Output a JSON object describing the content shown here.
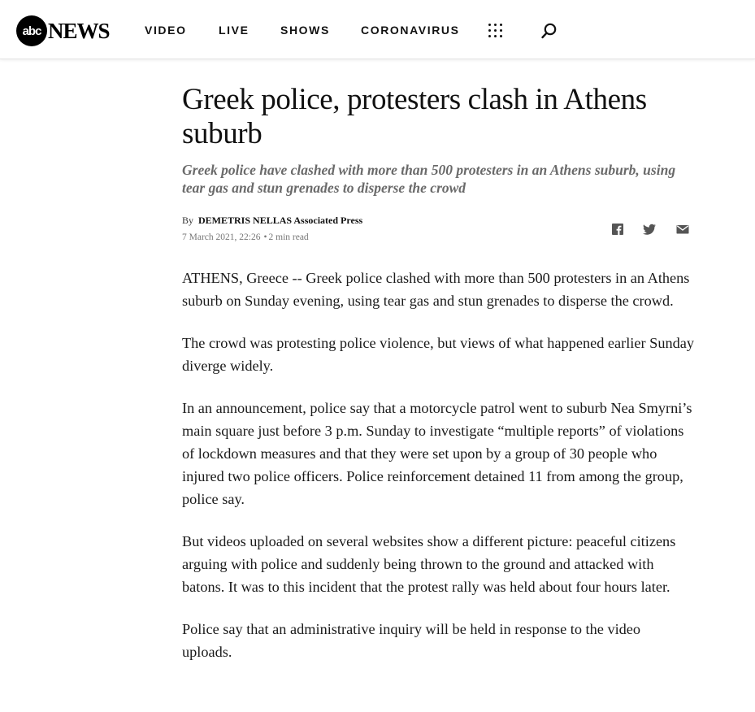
{
  "nav": {
    "logo_badge": "abc",
    "logo_word": "NEWS",
    "links": [
      "VIDEO",
      "LIVE",
      "SHOWS",
      "CORONAVIRUS"
    ],
    "icons": [
      "grid-menu-icon",
      "search-icon"
    ]
  },
  "article": {
    "headline": "Greek police, protesters clash in Athens suburb",
    "subhead": "Greek police have clashed with more than 500 protesters in an Athens suburb, using tear gas and stun grenades to disperse the crowd",
    "byline": {
      "prefix": "By",
      "author": "DEMETRIS NELLAS Associated Press"
    },
    "date": "7 March 2021, 22:26",
    "read_time": "2 min read",
    "share_icons": [
      "facebook-icon",
      "twitter-icon",
      "email-icon"
    ],
    "paragraphs": [
      "ATHENS, Greece -- Greek police clashed with more than 500 protesters in an Athens suburb on Sunday evening, using tear gas and stun grenades to disperse the crowd.",
      "The crowd was protesting police violence, but views of what happened earlier Sunday diverge widely.",
      "In an announcement, police say that a motorcycle patrol went to suburb Nea Smyrni’s main square just before 3 p.m. Sunday to investigate “multiple reports” of violations of lockdown measures and that they were set upon by a group of 30 people who injured two police officers. Police reinforcement detained 11 from among the group, police say.",
      "But videos uploaded on several websites show a different picture: peaceful citizens arguing with police and suddenly being thrown to the ground and attacked with batons. It was to this incident that the protest rally was held about four hours later.",
      "Police say that an administrative inquiry will be held in response to the video uploads."
    ]
  },
  "colors": {
    "logo": "#000000",
    "subhead": "#6a6a6a",
    "meta": "#777777",
    "text": "#1a1a1a"
  }
}
